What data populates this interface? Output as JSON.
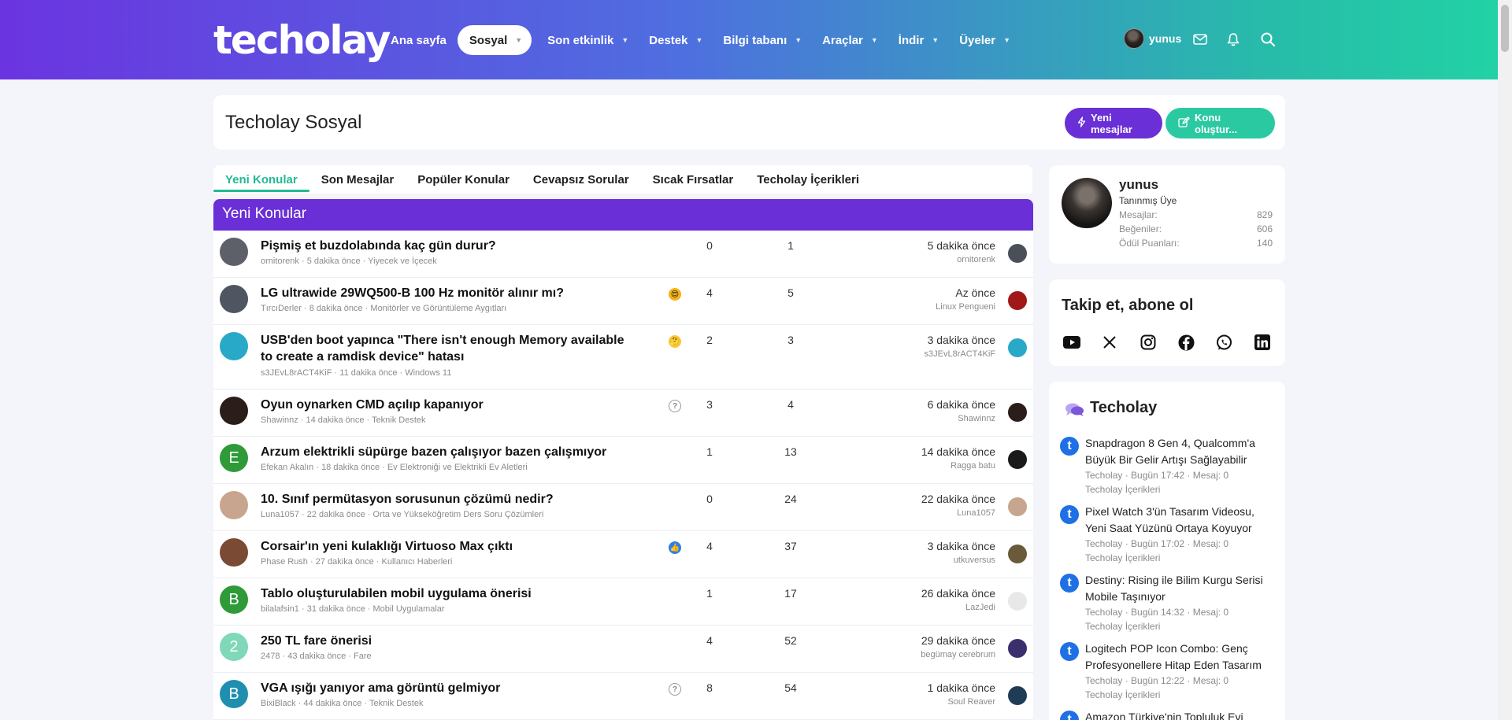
{
  "header": {
    "logo": "techolay",
    "nav": [
      {
        "label": "Ana sayfa",
        "has_menu": false,
        "active": false
      },
      {
        "label": "Sosyal",
        "has_menu": true,
        "active": true
      },
      {
        "label": "Son etkinlik",
        "has_menu": true,
        "active": false
      },
      {
        "label": "Destek",
        "has_menu": true,
        "active": false
      },
      {
        "label": "Bilgi tabanı",
        "has_menu": true,
        "active": false
      },
      {
        "label": "Araçlar",
        "has_menu": true,
        "active": false
      },
      {
        "label": "İndir",
        "has_menu": true,
        "active": false
      },
      {
        "label": "Üyeler",
        "has_menu": true,
        "active": false
      }
    ],
    "username": "yunus",
    "icons": [
      "mail-icon",
      "bell-icon",
      "search-icon"
    ]
  },
  "page": {
    "title": "Techolay Sosyal",
    "new_messages_button": "Yeni mesajlar",
    "create_thread_button": "Konu oluştur..."
  },
  "tabs": [
    "Yeni Konular",
    "Son Mesajlar",
    "Popüler Konular",
    "Cevapsız Sorular",
    "Sıcak Fırsatlar",
    "Techolay İçerikleri"
  ],
  "list": {
    "heading": "Yeni Konular",
    "threads": [
      {
        "title": "Pişmiş et buzdolabında kaç gün durur?",
        "author": "ornitorenk",
        "time": "5 dakika önce",
        "forum": "Yiyecek ve İçecek",
        "prefix_icon": "",
        "replies": "0",
        "views": "1",
        "last_time": "5 dakika önce",
        "last_user": "ornitorenk",
        "avatar_letter": "",
        "avatar_color": "#5d6068",
        "last_avatar_color": "#4a5058"
      },
      {
        "title": "LG ultrawide 29WQ500-B 100 Hz monitör alınır mı?",
        "author": "TırcıDerler",
        "time": "8 dakika önce",
        "forum": "Monitörler ve Görüntüleme Aygıtları",
        "prefix_icon": "heart-eyes-emoji-icon",
        "replies": "4",
        "views": "5",
        "last_time": "Az önce",
        "last_user": "Linux Pengueni",
        "avatar_letter": "",
        "avatar_color": "#4f5561",
        "last_avatar_color": "#a01818"
      },
      {
        "title": "USB'den boot yapınca \"There isn't enough Memory available to create a ramdisk device\" hatası",
        "author": "s3JEvL8rACT4KiF",
        "time": "11 dakika önce",
        "forum": "Windows 11",
        "prefix_icon": "thinking-emoji-icon",
        "replies": "2",
        "views": "3",
        "last_time": "3 dakika önce",
        "last_user": "s3JEvL8rACT4KiF",
        "avatar_letter": "",
        "avatar_color": "#27a9c7",
        "last_avatar_color": "#27a9c7"
      },
      {
        "title": "Oyun oynarken CMD açılıp kapanıyor",
        "author": "Shawinnz",
        "time": "14 dakika önce",
        "forum": "Teknik Destek",
        "prefix_icon": "question-icon",
        "replies": "3",
        "views": "4",
        "last_time": "6 dakika önce",
        "last_user": "Shawinnz",
        "avatar_letter": "",
        "avatar_color": "#2a1d1a",
        "last_avatar_color": "#2a1d1a"
      },
      {
        "title": "Arzum elektrikli süpürge bazen çalışıyor bazen çalışmıyor",
        "author": "Efekan Akalın",
        "time": "18 dakika önce",
        "forum": "Ev Elektroniği ve Elektrikli Ev Aletleri",
        "prefix_icon": "",
        "replies": "1",
        "views": "13",
        "last_time": "14 dakika önce",
        "last_user": "Ragga batu",
        "avatar_letter": "E",
        "avatar_color": "#2e9a38",
        "last_avatar_color": "#1a1a1a"
      },
      {
        "title": "10. Sınıf permütasyon sorusunun çözümü nedir?",
        "author": "Luna1057",
        "time": "22 dakika önce",
        "forum": "Orta ve Yükseköğretim Ders Soru Çözümleri",
        "prefix_icon": "",
        "replies": "0",
        "views": "24",
        "last_time": "22 dakika önce",
        "last_user": "Luna1057",
        "avatar_letter": "",
        "avatar_color": "#c7a58e",
        "last_avatar_color": "#c7a58e"
      },
      {
        "title": "Corsair'ın yeni kulaklığı Virtuoso Max çıktı",
        "author": "Phase Rush",
        "time": "27 dakika önce",
        "forum": "Kullanıcı Haberleri",
        "prefix_icon": "thumbs-up-icon",
        "replies": "4",
        "views": "37",
        "last_time": "3 dakika önce",
        "last_user": "utkuversus",
        "avatar_letter": "",
        "avatar_color": "#7a4a35",
        "last_avatar_color": "#6b5a3a"
      },
      {
        "title": "Tablo oluşturulabilen mobil uygulama önerisi",
        "author": "bilalafsin1",
        "time": "31 dakika önce",
        "forum": "Mobil Uygulamalar",
        "prefix_icon": "",
        "replies": "1",
        "views": "17",
        "last_time": "26 dakika önce",
        "last_user": "LazJedi",
        "avatar_letter": "B",
        "avatar_color": "#2e9a38",
        "last_avatar_color": "#e8e8e8"
      },
      {
        "title": "250 TL fare önerisi",
        "author": "2478",
        "time": "43 dakika önce",
        "forum": "Fare",
        "prefix_icon": "",
        "replies": "4",
        "views": "52",
        "last_time": "29 dakika önce",
        "last_user": "begümay cerebrum",
        "avatar_letter": "2",
        "avatar_color": "#7fd8b8",
        "last_avatar_color": "#3b2f6e"
      },
      {
        "title": "VGA ışığı yanıyor ama görüntü gelmiyor",
        "author": "BixiBlack",
        "time": "44 dakika önce",
        "forum": "Teknik Destek",
        "prefix_icon": "question-icon",
        "replies": "8",
        "views": "54",
        "last_time": "1 dakika önce",
        "last_user": "Soul Reaver",
        "avatar_letter": "B",
        "avatar_color": "#1f8fb0",
        "last_avatar_color": "#1e3c55"
      }
    ]
  },
  "profile": {
    "name": "yunus",
    "role": "Tanınmış Üye",
    "stats": [
      {
        "label": "Mesajlar:",
        "value": "829"
      },
      {
        "label": "Beğeniler:",
        "value": "606"
      },
      {
        "label": "Ödül Puanları:",
        "value": "140"
      }
    ]
  },
  "follow": {
    "title": "Takip et, abone ol",
    "icons": [
      "youtube-icon",
      "x-icon",
      "instagram-icon",
      "facebook-icon",
      "whatsapp-icon",
      "linkedin-icon"
    ]
  },
  "news": {
    "title": "Techolay",
    "items": [
      {
        "text": "Snapdragon 8 Gen 4, Qualcomm'a Büyük Bir Gelir Artışı Sağlayabilir",
        "meta": "Techolay · Bugün 17:42 · Mesaj: 0",
        "category": "Techolay İçerikleri"
      },
      {
        "text": "Pixel Watch 3'ün Tasarım Videosu, Yeni Saat Yüzünü Ortaya Koyuyor",
        "meta": "Techolay · Bugün 17:02 · Mesaj: 0",
        "category": "Techolay İçerikleri"
      },
      {
        "text": "Destiny: Rising ile Bilim Kurgu Serisi Mobile Taşınıyor",
        "meta": "Techolay · Bugün 14:32 · Mesaj: 0",
        "category": "Techolay İçerikleri"
      },
      {
        "text": "Logitech POP Icon Combo: Genç Profesyonellere Hitap Eden Tasarım",
        "meta": "Techolay · Bugün 12:22 · Mesaj: 0",
        "category": "Techolay İçerikleri"
      },
      {
        "text": "Amazon Türkiye'nin Topluluk Evi",
        "meta": "",
        "category": ""
      }
    ]
  }
}
